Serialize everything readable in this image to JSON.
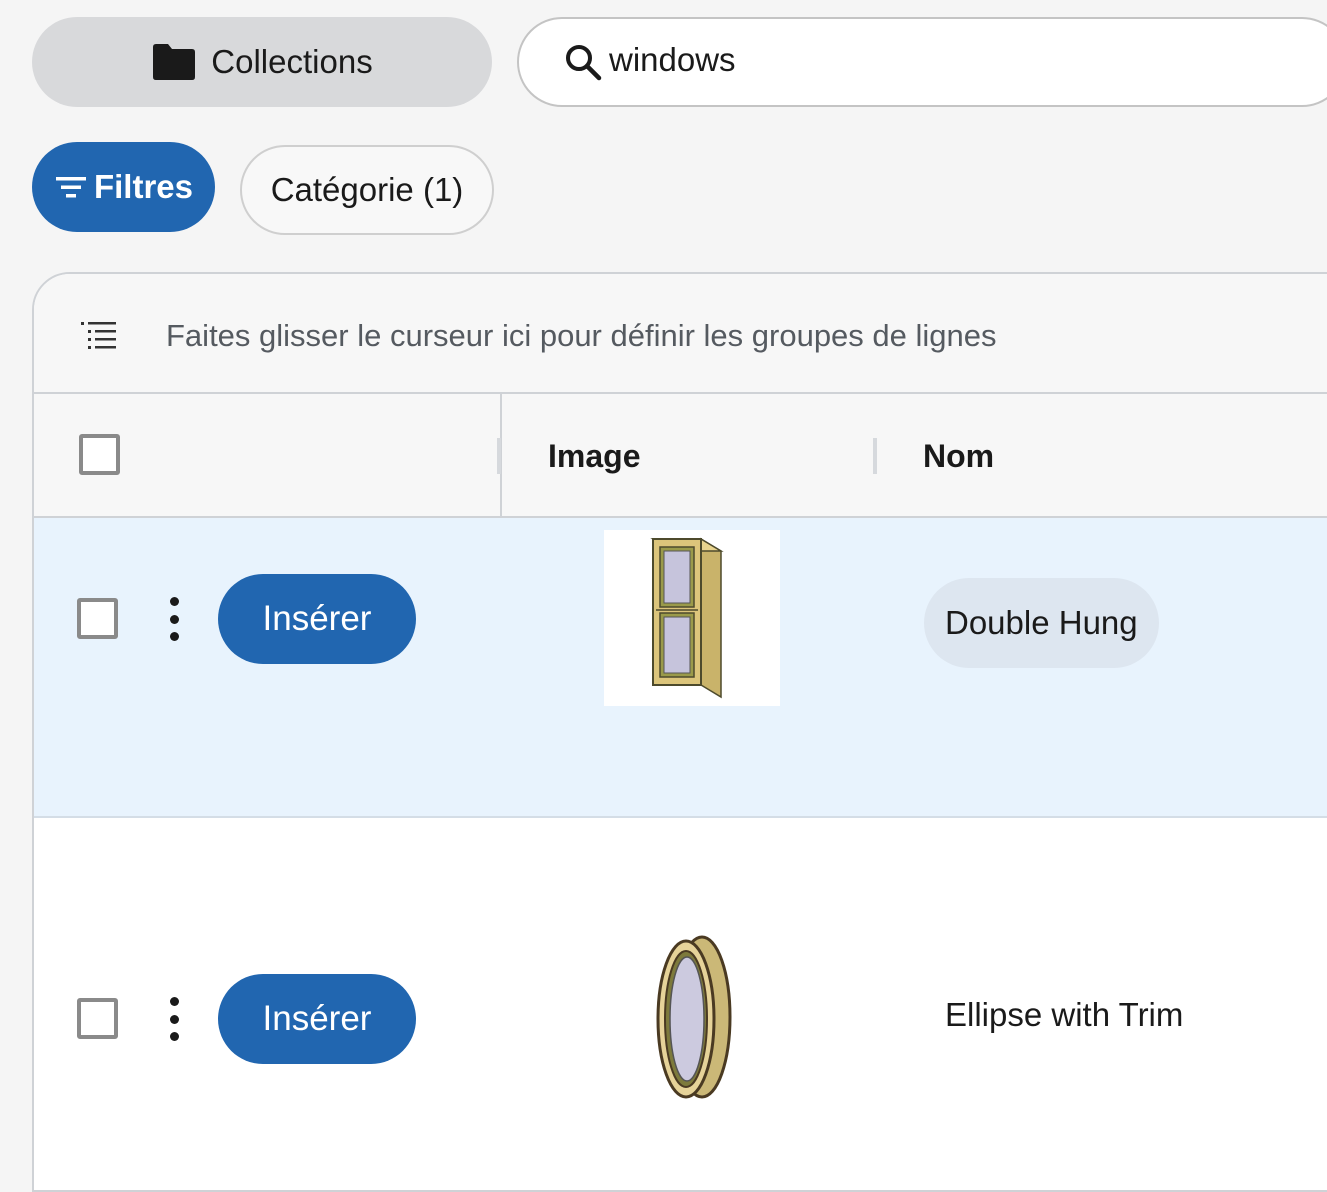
{
  "toolbar": {
    "collections_label": "Collections",
    "collections_icon": "folder-icon",
    "search_value": "windows",
    "search_icon": "search-icon"
  },
  "filters": {
    "filters_label": "Filtres",
    "filters_icon": "filter-icon",
    "category_label": "Catégorie (1)"
  },
  "grid": {
    "group_hint": "Faites glisser le curseur ici pour définir les groupes de lignes",
    "group_icon": "row-group-icon",
    "columns": [
      "Image",
      "Nom"
    ],
    "rows": [
      {
        "insert_label": "Insérer",
        "name": "Double Hung",
        "image_icon": "double-hung-window-thumbnail",
        "selected": true
      },
      {
        "insert_label": "Insérer",
        "name": "Ellipse with Trim",
        "image_icon": "ellipse-window-thumbnail",
        "selected": false
      }
    ]
  },
  "colors": {
    "accent": "#2166b0",
    "selected_row": "#e8f3fd",
    "chip_bg": "#dde6f0"
  }
}
